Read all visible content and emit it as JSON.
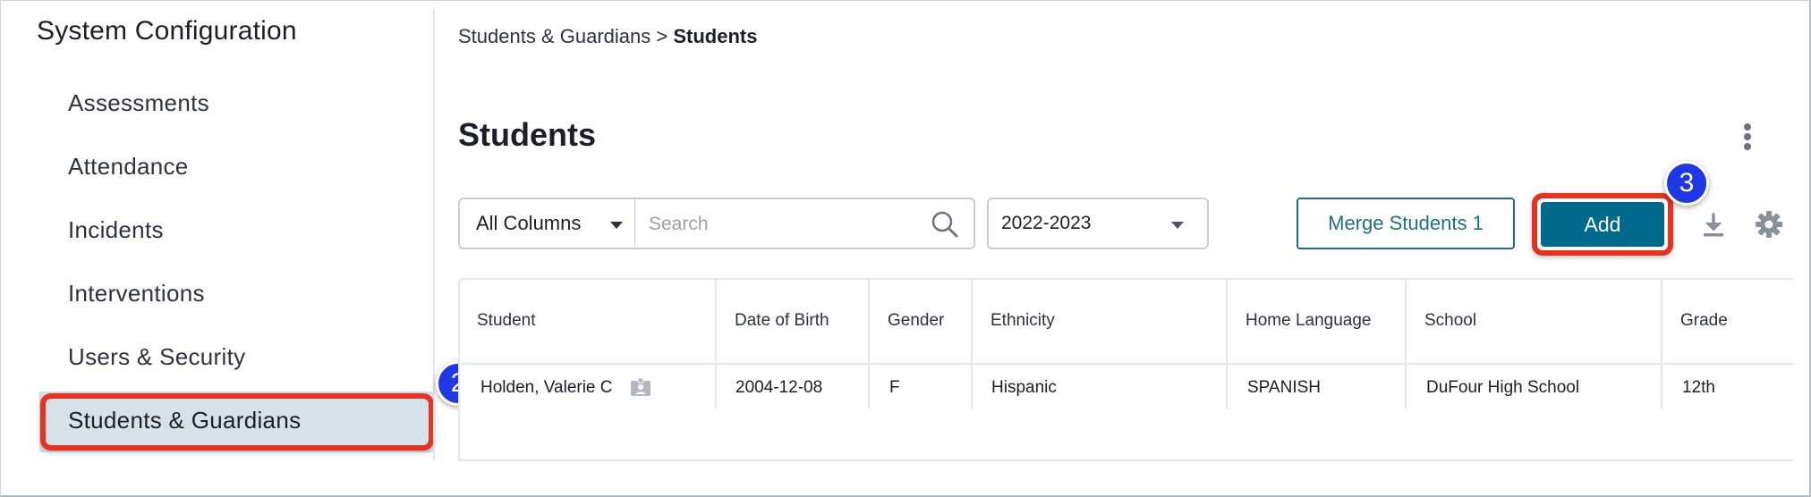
{
  "sidebar": {
    "title": "System Configuration",
    "items": [
      {
        "label": "Assessments"
      },
      {
        "label": "Attendance"
      },
      {
        "label": "Incidents"
      },
      {
        "label": "Interventions"
      },
      {
        "label": "Users & Security"
      },
      {
        "label": "Students & Guardians",
        "active": true
      }
    ]
  },
  "callouts": {
    "two": "2",
    "three": "3"
  },
  "breadcrumb": {
    "parent": "Students & Guardians",
    "separator": ">",
    "current": "Students"
  },
  "page": {
    "title": "Students"
  },
  "toolbar": {
    "column_filter": "All Columns",
    "search_placeholder": "Search",
    "year": "2022-2023",
    "merge_label": "Merge Students 1",
    "add_label": "Add"
  },
  "icons": {
    "search": "search-icon",
    "download": "download-icon",
    "settings": "gear-icon",
    "more": "kebab-menu-icon",
    "id_card": "id-card-icon",
    "dropdown": "caret-down-icon"
  },
  "table": {
    "columns": [
      "Student",
      "Date of Birth",
      "Gender",
      "Ethnicity",
      "Home Language",
      "School",
      "Grade"
    ],
    "rows": [
      [
        "Holden, Valerie C",
        "2004-12-08",
        "F",
        "Hispanic",
        "SPANISH",
        "DuFour High School",
        "12th"
      ]
    ]
  },
  "colors": {
    "accent": "#006a8c",
    "highlight": "#e8321f",
    "callout": "#1f38e6",
    "active_nav_bg": "#d6e2ea"
  }
}
